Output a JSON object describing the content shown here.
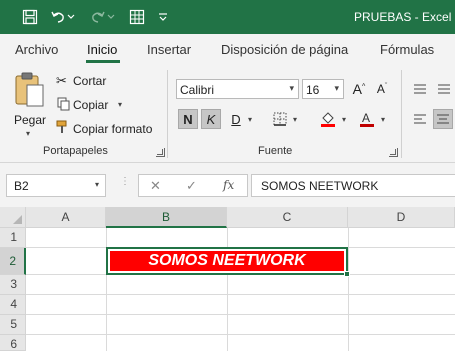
{
  "titlebar": {
    "title": "PRUEBAS  -  Excel",
    "icons": [
      "save-icon",
      "undo-icon",
      "redo-icon",
      "table-icon",
      "customize-qat-icon"
    ]
  },
  "tabs": [
    "Archivo",
    "Inicio",
    "Insertar",
    "Disposición de página",
    "Fórmulas"
  ],
  "ribbon": {
    "portapapeles": {
      "paste": "Pegar",
      "cut": "Cortar",
      "copy": "Copiar",
      "format_painter": "Copiar formato",
      "label": "Portapapeles"
    },
    "fuente": {
      "font": "Calibri",
      "size": "16",
      "bold": "N",
      "italic": "K",
      "underline": "D",
      "label": "Fuente"
    }
  },
  "formula_bar": {
    "name_box": "B2",
    "fx": "fx",
    "value": "SOMOS NEETWORK"
  },
  "sheet": {
    "columns": [
      "A",
      "B",
      "C",
      "D"
    ],
    "rows": [
      "1",
      "2",
      "3",
      "4",
      "5",
      "6"
    ],
    "cell_b2": "SOMOS NEETWORK"
  },
  "colors": {
    "accent": "#217346",
    "cell_fill": "#ff0000",
    "cell_text": "#ffffff"
  }
}
